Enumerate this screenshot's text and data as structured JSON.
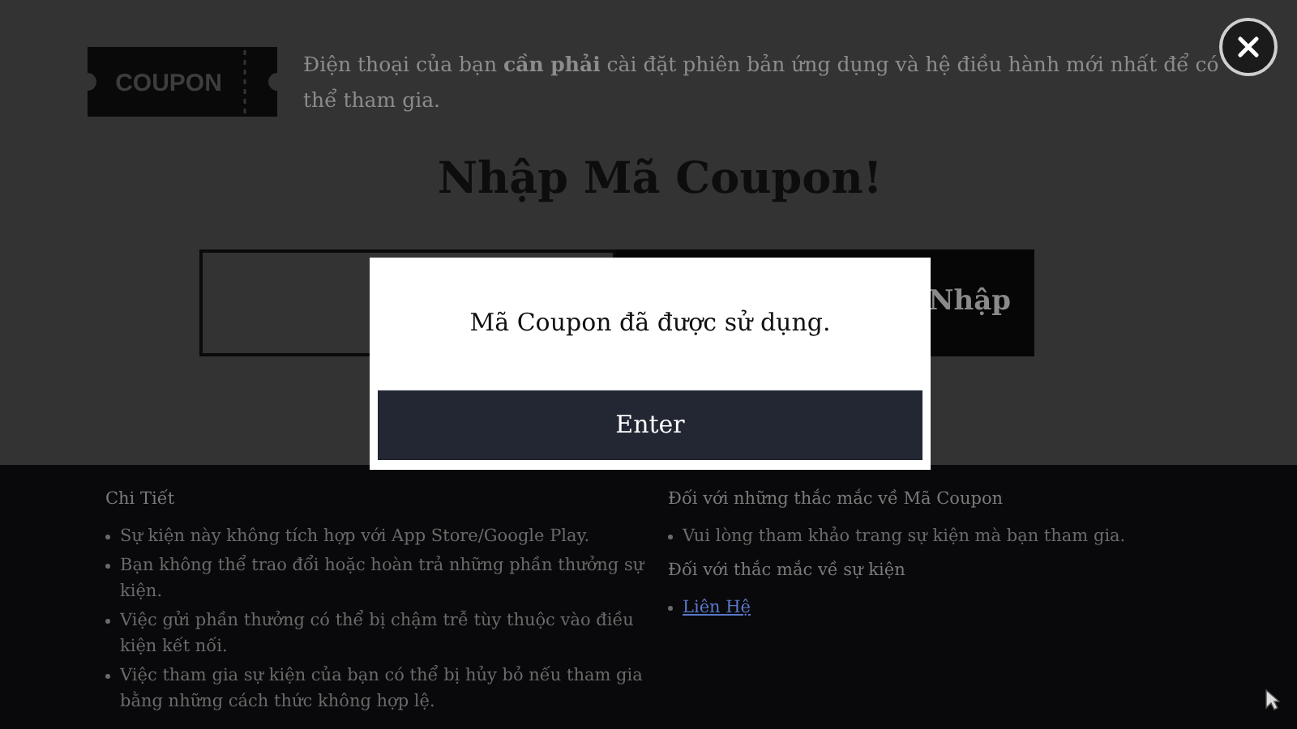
{
  "header": {
    "ticket_label": "COUPON",
    "notice": "Điện thoại của bạn **cần phải** cài đặt phiên bản ứng dụng và hệ điều hành mới nhất để có thể tham gia."
  },
  "title": "Nhập Mã Coupon!",
  "submit_button": "Nhập",
  "footer": {
    "columns": [
      {
        "sections": [
          {
            "heading": "Chi Tiết",
            "items": [
              {
                "kind": "text",
                "text": "Sự kiện này không tích hợp với App Store/Google Play."
              },
              {
                "kind": "text",
                "text": "Bạn không thể trao đổi hoặc hoàn trả những phần thưởng sự kiện."
              },
              {
                "kind": "text",
                "text": "Việc gửi phần thưởng có thể bị chậm trễ tùy thuộc vào điều kiện kết nối."
              },
              {
                "kind": "text",
                "text": "Việc tham gia sự kiện của bạn có thể bị hủy bỏ nếu tham gia bằng những cách thức không hợp lệ."
              }
            ]
          }
        ]
      },
      {
        "sections": [
          {
            "heading": "Đối với những thắc mắc về Mã Coupon",
            "items": [
              {
                "kind": "text",
                "text": "Vui lòng tham khảo trang sự kiện mà bạn tham gia."
              }
            ]
          },
          {
            "heading": "Đối với thắc mắc về sự kiện",
            "items": [
              {
                "kind": "link",
                "text": "Liên Hệ"
              }
            ]
          }
        ]
      }
    ]
  },
  "dialog": {
    "message": "Mã Coupon đã được sử dụng.",
    "button": "Enter"
  }
}
